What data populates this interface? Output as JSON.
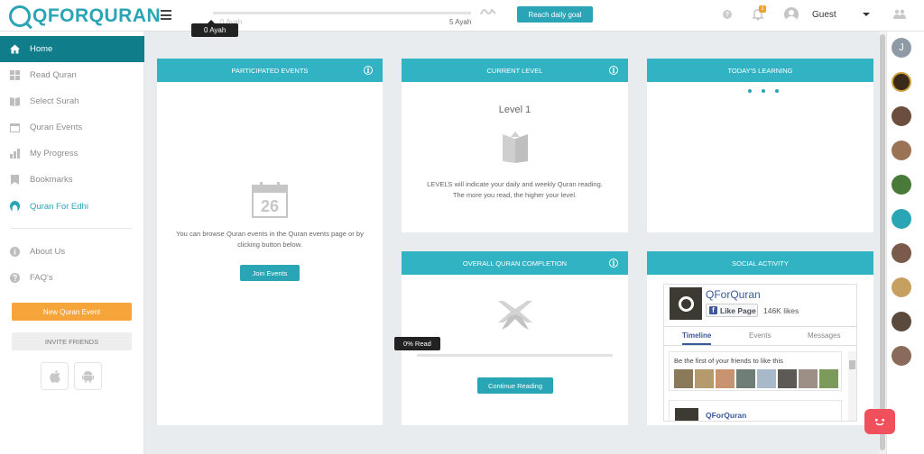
{
  "brand": {
    "name": "QFORQURAN",
    "accent": "#2aa5b5",
    "header_color": "#32b3c4",
    "active_nav": "#107d8b",
    "orange": "#f5a53a"
  },
  "topbar": {
    "goal_mini_label": "0 Ayah",
    "goal_max_label": "5 Ayah",
    "goal_tooltip": "0 Ayah",
    "goal_progress": 0,
    "reach_goal_button": "Reach daily goal",
    "help_icon": "?",
    "notification_count": "1",
    "user_name": "Guest"
  },
  "sidebar": {
    "items": [
      {
        "label": "Home",
        "icon": "home-icon"
      },
      {
        "label": "Read Quran",
        "icon": "grid-icon"
      },
      {
        "label": "Select Surah",
        "icon": "book-icon"
      },
      {
        "label": "Quran Events",
        "icon": "calendar-icon"
      },
      {
        "label": "My Progress",
        "icon": "chart-icon"
      },
      {
        "label": "Bookmarks",
        "icon": "bookmark-icon"
      },
      {
        "label": "Quran For Edhi",
        "icon": "edhi-icon"
      },
      {
        "label": "About Us",
        "icon": "info-icon"
      },
      {
        "label": "FAQ's",
        "icon": "question-icon"
      }
    ],
    "new_event_button": "New Quran Event",
    "invite_button": "INVITE FRIENDS",
    "store_icons": [
      "apple-icon",
      "android-icon"
    ]
  },
  "cards": {
    "participated": {
      "title": "PARTICIPATED EVENTS",
      "calendar_day": "26",
      "description": "You can browse Quran events in the Quran events page or by clicking button below.",
      "button": "Join Events"
    },
    "current_level": {
      "title": "CURRENT LEVEL",
      "level": "Level 1",
      "description": "LEVELS will indicate your daily and weekly Quran reading. The more you read, the higher your level."
    },
    "todays_learning": {
      "title": "TODAY'S LEARNING"
    },
    "overall": {
      "title": "OVERALL QURAN COMPLETION",
      "progress_tooltip": "0% Read",
      "progress": 0,
      "button": "Continue Reading"
    },
    "social": {
      "title": "SOCIAL ACTIVITY",
      "page_name": "QForQuran",
      "like_button": "Like Page",
      "likes": "146K likes",
      "tabs": [
        "Timeline",
        "Events",
        "Messages"
      ],
      "friends_text": "Be the first of your friends to like this",
      "post_name": "QForQuran"
    }
  },
  "rail": {
    "first_initial": "J"
  }
}
